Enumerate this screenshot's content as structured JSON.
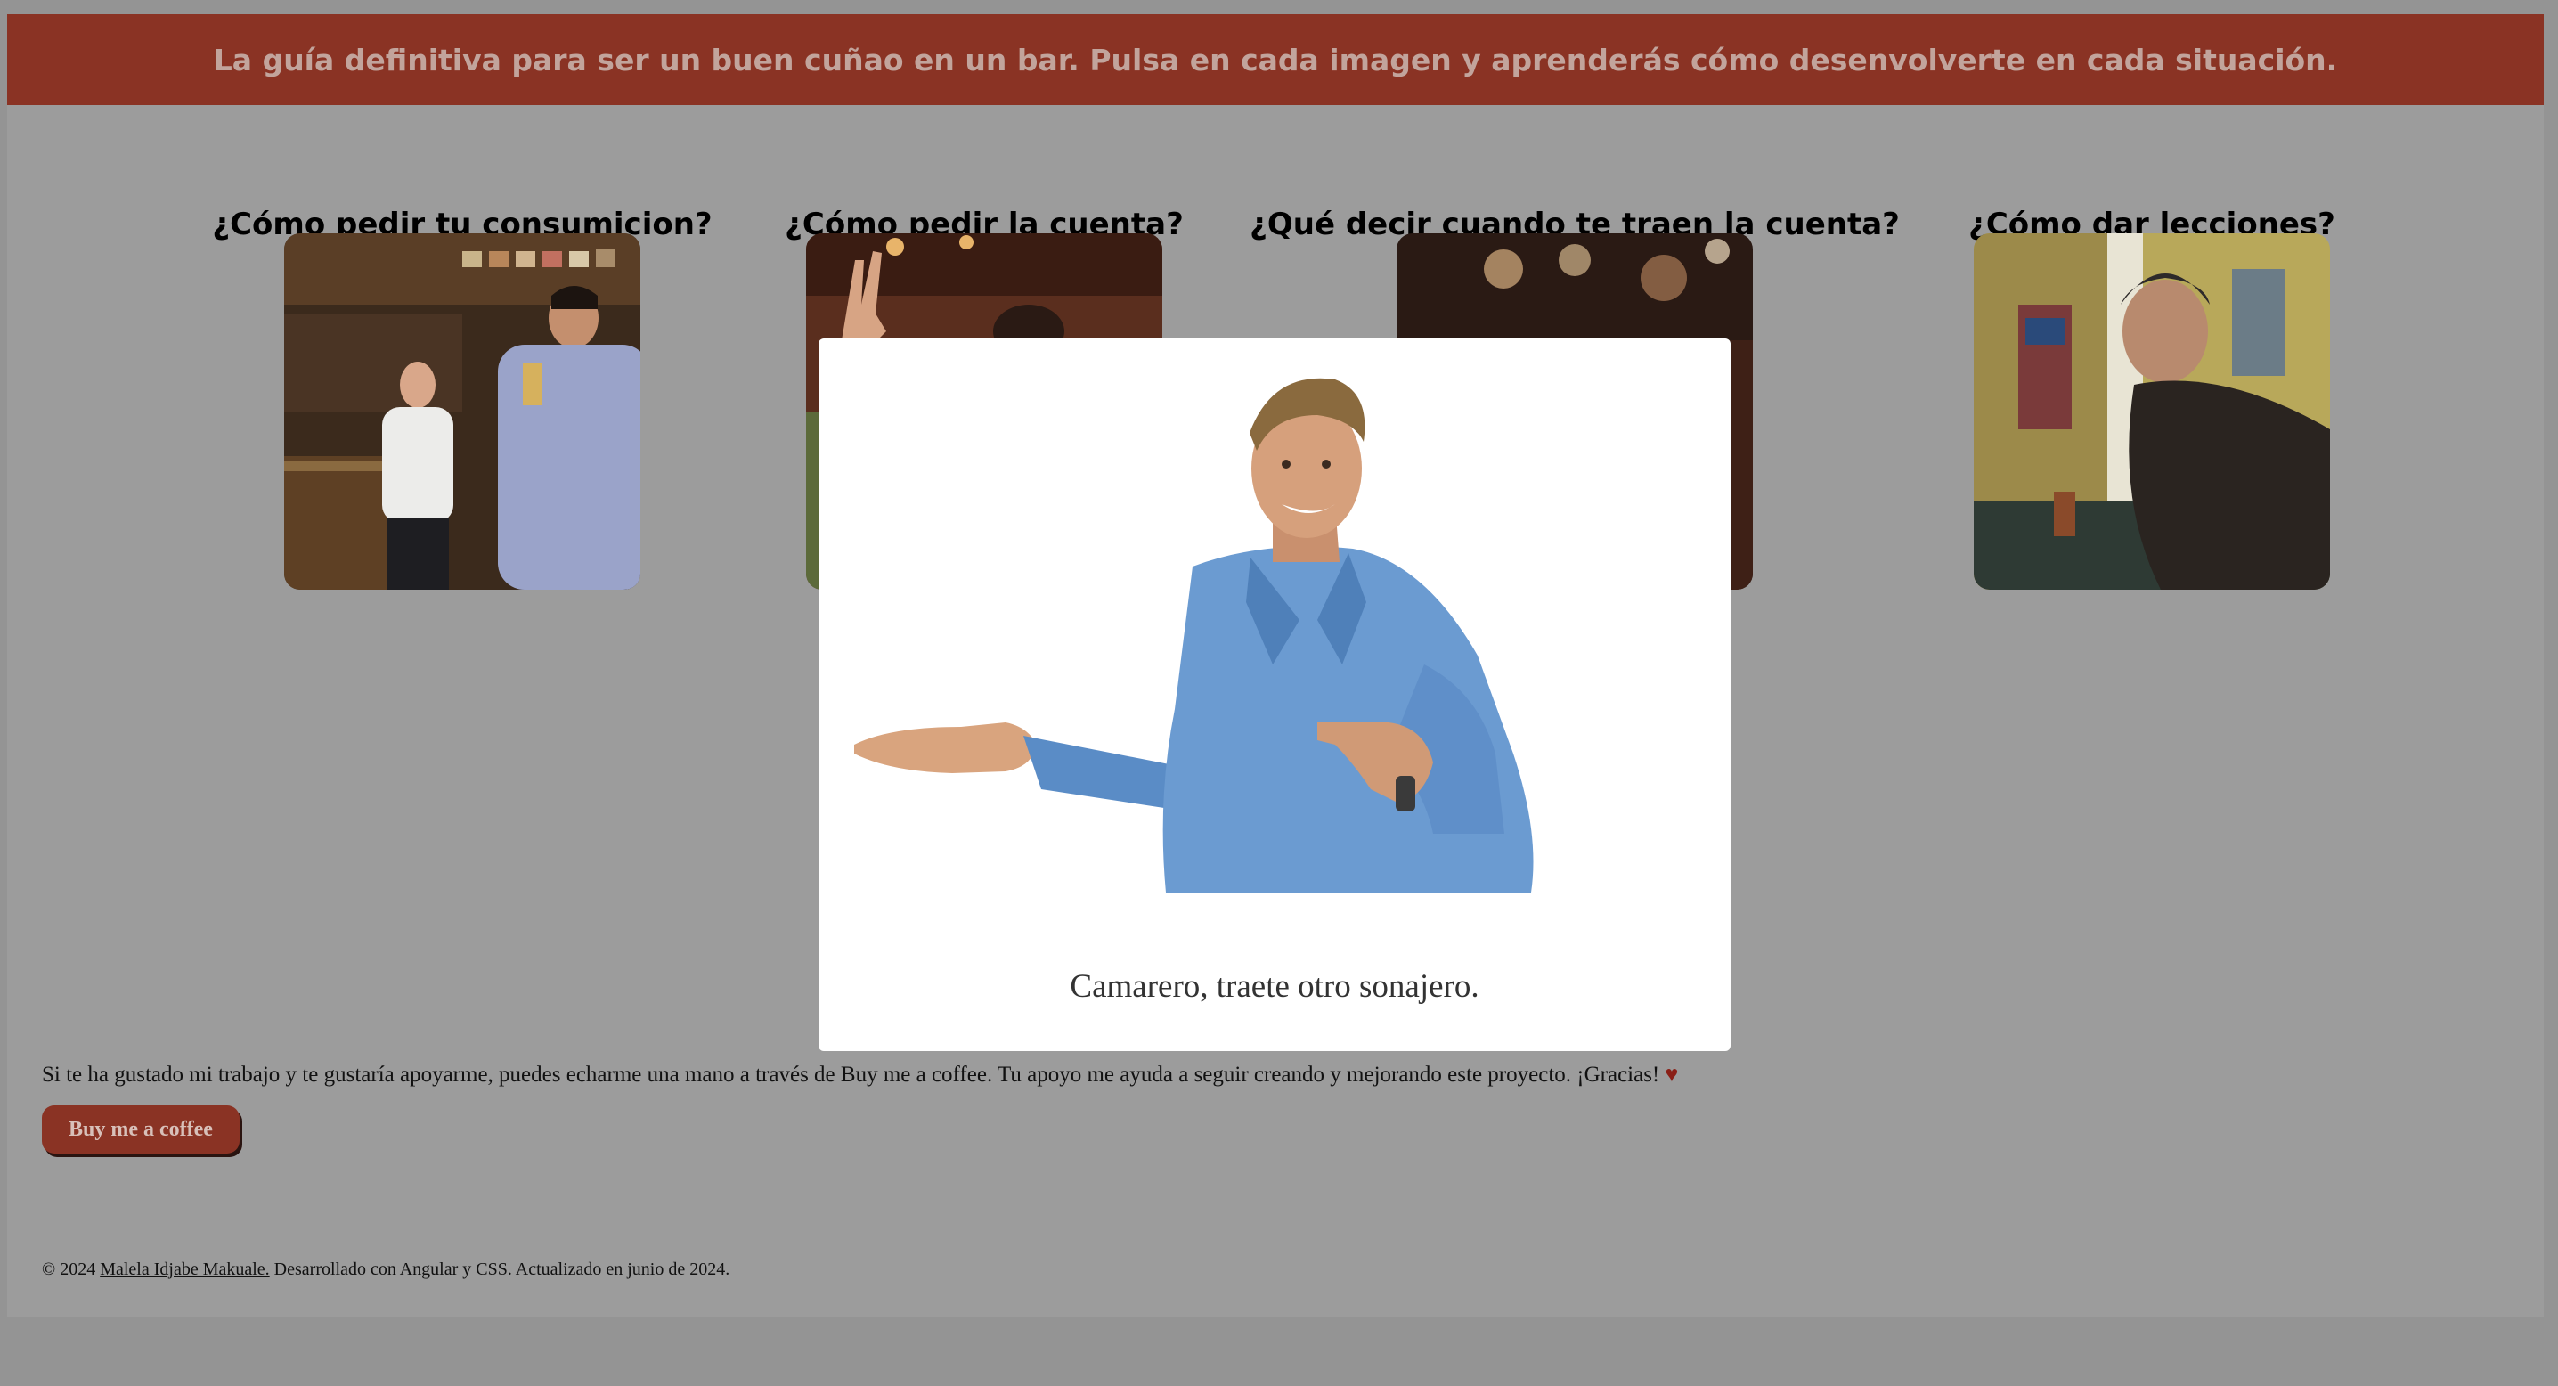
{
  "banner": {
    "text": "La guía definitiva para ser un buen cuñao en un bar. Pulsa en cada imagen y aprenderás cómo desenvolverte en cada situación."
  },
  "cards": [
    {
      "title": "¿Cómo pedir tu consumicion?",
      "image_icon": "bar-drinking-photo"
    },
    {
      "title": "¿Cómo pedir la cuenta?",
      "image_icon": "waving-hand-photo"
    },
    {
      "title": "¿Qué decir cuando te traen la cuenta?",
      "image_icon": "bar-bokeh-photo"
    },
    {
      "title": "¿Cómo dar lecciones?",
      "image_icon": "man-at-counter-photo"
    }
  ],
  "support": {
    "text": "Si te ha gustado mi trabajo y te gustaría apoyarme, puedes echarme una mano a través de Buy me a coffee. Tu apoyo me ayuda a seguir creando y mejorando este proyecto. ¡Gracias!",
    "heart": "♥",
    "button_label": "Buy me a coffee"
  },
  "footer": {
    "prefix": "© 2024 ",
    "author": "Malela Idjabe Makuale.",
    "suffix": " Desarrollado con Angular y CSS. Actualizado en junio de 2024."
  },
  "modal": {
    "caption": "Camarero, traete otro sonajero."
  },
  "colors": {
    "accent": "#8a3324",
    "overlay": "#949494"
  }
}
